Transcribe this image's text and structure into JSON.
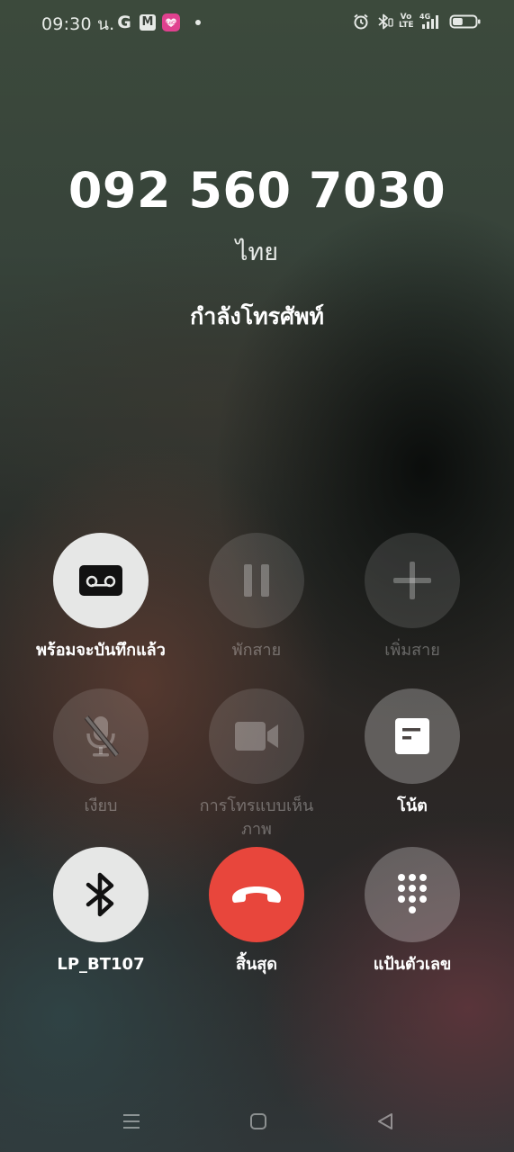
{
  "status_bar": {
    "time": "09:30 น.",
    "left_icons": [
      {
        "icon": "google-icon",
        "text": "G"
      },
      {
        "icon": "gmail-icon",
        "text": "M"
      },
      {
        "icon": "app-notification-icon",
        "text": "LoG"
      },
      {
        "icon": "more-notifications-dot-icon"
      }
    ],
    "right_icons": [
      "alarm-icon",
      "bluetooth-icon",
      "volte-icon",
      "4g-signal-icon",
      "battery-icon"
    ],
    "volte_text": "Vo LTE",
    "network_text": "4G",
    "battery_level": 0.45
  },
  "call": {
    "number": "092 560 7030",
    "location": "ไทย",
    "status": "กำลังโทรศัพท์"
  },
  "controls": {
    "record": {
      "label": "พร้อมจะบันทึกแล้ว",
      "icon": "cassette-icon",
      "enabled": true
    },
    "hold": {
      "label": "พักสาย",
      "icon": "pause-icon",
      "enabled": false
    },
    "add_call": {
      "label": "เพิ่มสาย",
      "icon": "plus-icon",
      "enabled": false
    },
    "mute": {
      "label": "เงียบ",
      "icon": "mic-off-icon",
      "enabled": false
    },
    "video_call": {
      "label": "การโทรแบบเห็นภาพ",
      "icon": "video-camera-icon",
      "enabled": false
    },
    "notes": {
      "label": "โน้ต",
      "icon": "note-icon",
      "enabled": true
    },
    "bluetooth": {
      "label": "LP_BT107",
      "icon": "bluetooth-icon",
      "enabled": true
    },
    "end_call": {
      "label": "สิ้นสุด",
      "icon": "phone-hangup-icon",
      "enabled": true
    },
    "keypad": {
      "label": "แป้นตัวเลข",
      "icon": "dialpad-icon",
      "enabled": true
    }
  },
  "nav_bar": [
    "menu-icon",
    "home-icon",
    "back-icon"
  ],
  "colors": {
    "end_call": "#e8463c",
    "active_button": "#e6e7e6",
    "text": "#ffffff"
  }
}
